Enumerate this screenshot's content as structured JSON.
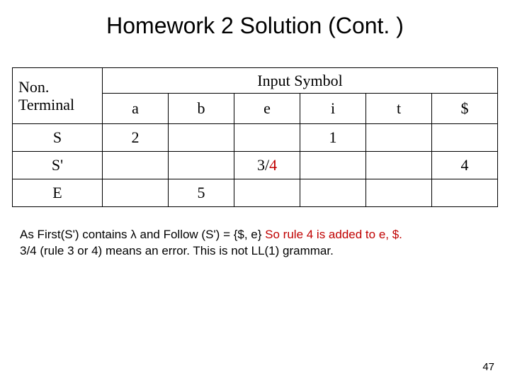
{
  "title": "Homework 2 Solution (Cont. )",
  "table": {
    "nt_header_l1": "Non.",
    "nt_header_l2": "Terminal",
    "input_header": "Input Symbol",
    "cols": {
      "a": "a",
      "b": "b",
      "e": "e",
      "i": "i",
      "t": "t",
      "dollar": "$"
    },
    "rows": {
      "S": {
        "label": "S",
        "a": "2",
        "b": "",
        "e": "",
        "i": "1",
        "t": "",
        "dollar": ""
      },
      "Sp": {
        "label": "S'",
        "a": "",
        "b": "",
        "e_pre": "3/",
        "e_err": "4",
        "i": "",
        "t": "",
        "dollar": "4"
      },
      "E": {
        "label": "E",
        "a": "",
        "b": "5",
        "e": "",
        "i": "",
        "t": "",
        "dollar": ""
      }
    }
  },
  "note": {
    "line1a": "As First(S') contains λ and Follow (S') = {$, e} ",
    "line1b": "So rule 4 is added to e, $.",
    "line2": "3/4 (rule 3 or 4) means an error. This is not LL(1) grammar."
  },
  "page_number": "47"
}
